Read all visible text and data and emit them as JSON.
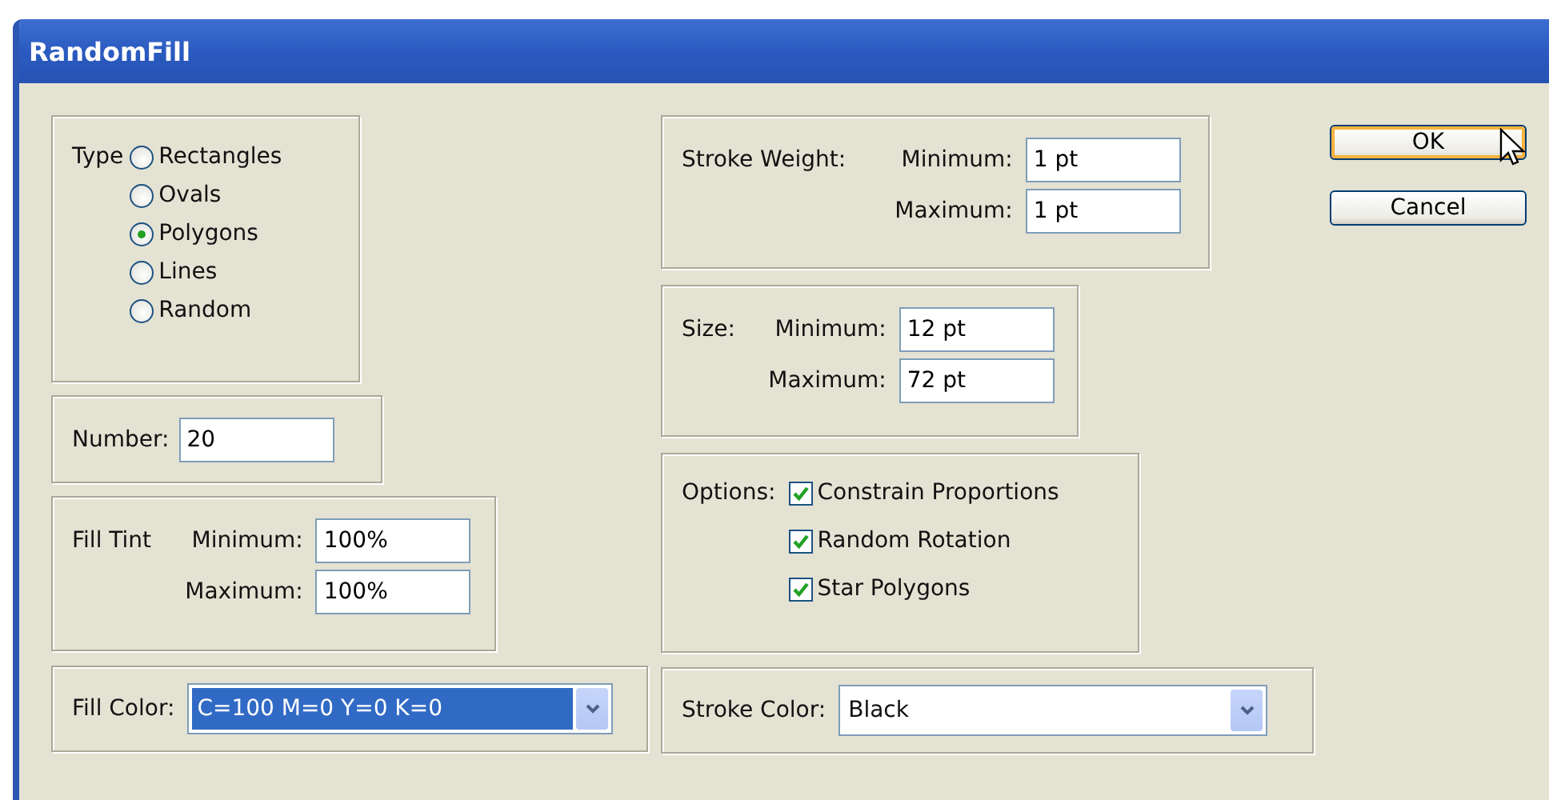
{
  "window": {
    "title": "RandomFill"
  },
  "type_group": {
    "label": "Type",
    "options": [
      {
        "label": "Rectangles",
        "selected": false
      },
      {
        "label": "Ovals",
        "selected": false
      },
      {
        "label": "Polygons",
        "selected": true
      },
      {
        "label": "Lines",
        "selected": false
      },
      {
        "label": "Random",
        "selected": false
      }
    ]
  },
  "number": {
    "label": "Number:",
    "value": "20"
  },
  "fill_tint": {
    "label": "Fill Tint",
    "minimum": {
      "label": "Minimum:",
      "value": "100%"
    },
    "maximum": {
      "label": "Maximum:",
      "value": "100%"
    }
  },
  "fill_color": {
    "label": "Fill Color:",
    "value": "C=100 M=0 Y=0 K=0",
    "focused": true
  },
  "stroke_weight": {
    "label": "Stroke Weight:",
    "minimum": {
      "label": "Minimum:",
      "value": "1 pt"
    },
    "maximum": {
      "label": "Maximum:",
      "value": "1 pt"
    }
  },
  "size": {
    "label": "Size:",
    "minimum": {
      "label": "Minimum:",
      "value": "12 pt"
    },
    "maximum": {
      "label": "Maximum:",
      "value": "72 pt"
    }
  },
  "options": {
    "label": "Options:",
    "items": [
      {
        "label": "Constrain Proportions",
        "checked": true
      },
      {
        "label": "Random Rotation",
        "checked": true
      },
      {
        "label": "Star Polygons",
        "checked": true
      }
    ]
  },
  "stroke_color": {
    "label": "Stroke Color:",
    "value": "Black",
    "focused": false
  },
  "buttons": [
    {
      "label": "OK",
      "default": true
    },
    {
      "label": "Cancel",
      "default": false
    }
  ]
}
